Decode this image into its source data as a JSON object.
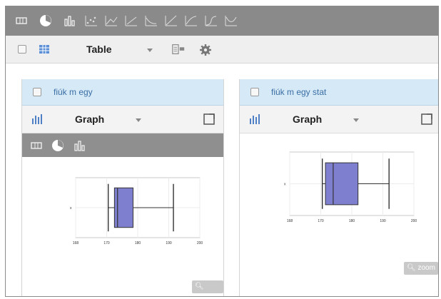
{
  "toolbar": {
    "icons": [
      "table-view-icon",
      "pie-chart-icon",
      "bar-chart-icon",
      "scatter-plot-icon",
      "line-chart-icon",
      "boxplot-icon",
      "histogram-icon",
      "regression-icon",
      "trend-icon",
      "area-icon",
      "function-icon"
    ]
  },
  "view_bar": {
    "view_label": "Table"
  },
  "panels": [
    {
      "title": "fiúk m egy",
      "view_label": "Graph",
      "zoom_label": "zoom",
      "chart_data": {
        "type": "boxplot",
        "xticks": [
          "168",
          "170",
          "180",
          "190",
          "200"
        ],
        "whisker_low": 170.5,
        "q1": 172.5,
        "median": 173.5,
        "q3": 178.5,
        "whisker_high": 191.5,
        "xlim": [
          160,
          200
        ],
        "ylabel": "x"
      }
    },
    {
      "title": "fiúk m egy stat",
      "view_label": "Graph",
      "zoom_label": "zoom",
      "chart_data": {
        "type": "boxplot",
        "xticks": [
          "168",
          "170",
          "180",
          "190",
          "200"
        ],
        "whisker_low": 170.5,
        "q1": 171.5,
        "median": 174,
        "q3": 182,
        "whisker_high": 192,
        "xlim": [
          160,
          200
        ],
        "ylabel": "x"
      }
    }
  ]
}
